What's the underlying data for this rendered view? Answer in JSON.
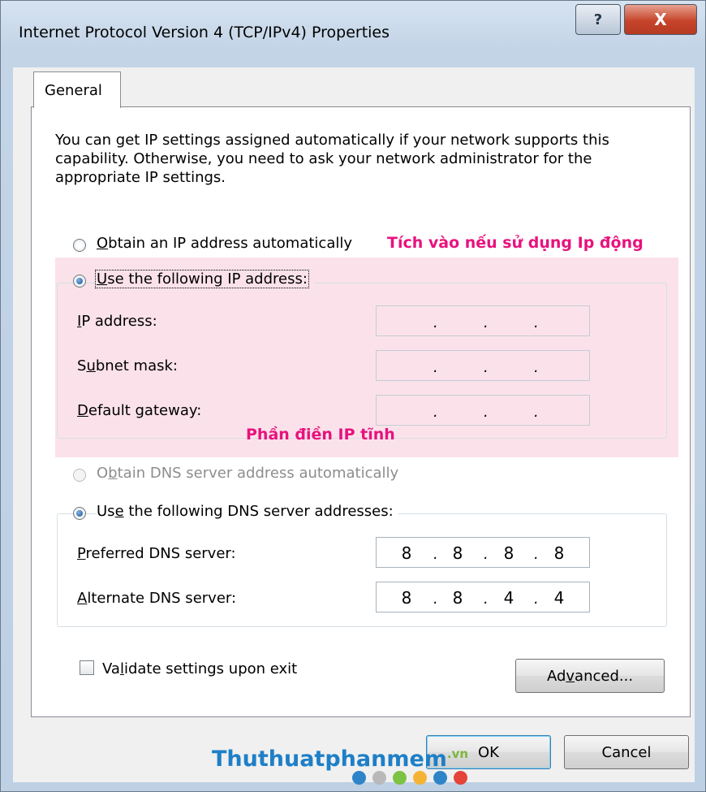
{
  "window": {
    "title": "Internet Protocol Version 4 (TCP/IPv4) Properties",
    "help_glyph": "?",
    "close_glyph": "X"
  },
  "tabs": [
    "General"
  ],
  "intro_text": "You can get IP settings assigned automatically if your network supports this capability. Otherwise, you need to ask your network administrator for the appropriate IP settings.",
  "ip_section": {
    "obtain_auto": {
      "pre": "",
      "key": "O",
      "post": "btain an IP address automatically",
      "selected": false
    },
    "use_following": {
      "pre": "",
      "key": "U",
      "post": "se the following IP address:",
      "selected": true
    },
    "fields": [
      {
        "pre": "",
        "key": "I",
        "post": "P address:",
        "value": [
          "",
          "",
          "",
          ""
        ]
      },
      {
        "pre": "S",
        "key": "u",
        "post": "bnet mask:",
        "value": [
          "",
          "",
          "",
          ""
        ]
      },
      {
        "pre": "",
        "key": "D",
        "post": "efault gateway:",
        "value": [
          "",
          "",
          "",
          ""
        ]
      }
    ]
  },
  "dns_section": {
    "obtain_auto": {
      "pre": "O",
      "key": "b",
      "post": "tain DNS server address automatically",
      "selected": false,
      "disabled": true
    },
    "use_following": {
      "pre": "Us",
      "key": "e",
      "post": " the following DNS server addresses:",
      "selected": true
    },
    "fields": [
      {
        "pre": "",
        "key": "P",
        "post": "referred DNS server:",
        "value": [
          "8",
          "8",
          "8",
          "8"
        ]
      },
      {
        "pre": "",
        "key": "A",
        "post": "lternate DNS server:",
        "value": [
          "8",
          "8",
          "4",
          "4"
        ]
      }
    ]
  },
  "validate": {
    "pre": "Va",
    "key": "l",
    "post": "idate settings upon exit",
    "checked": false
  },
  "buttons": {
    "advanced": {
      "pre": "Ad",
      "key": "v",
      "post": "anced..."
    },
    "ok": "OK",
    "cancel": "Cancel"
  },
  "annotations": {
    "dynamic_ip": "Tích vào nếu sử dụng Ip động",
    "static_ip": "Phần điền IP tĩnh"
  },
  "watermark": {
    "text": "Thuthuatphanmem",
    "ext": ".vn",
    "dot_colors": [
      "#2f84c8",
      "#b9b9b9",
      "#7cc243",
      "#f5b335",
      "#2f84c8",
      "#e4443a"
    ]
  }
}
